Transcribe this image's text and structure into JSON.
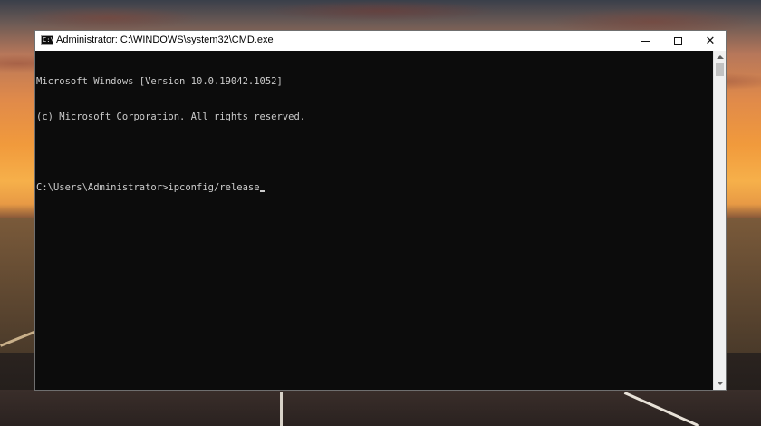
{
  "window": {
    "title": "Administrator: C:\\WINDOWS\\system32\\CMD.exe",
    "app_icon_glyph": "C:\\"
  },
  "window_controls": {
    "minimize_icon": "minimize-icon",
    "maximize_icon": "maximize-icon",
    "close_glyph": "✕"
  },
  "console": {
    "lines": [
      "Microsoft Windows [Version 10.0.19042.1052]",
      "(c) Microsoft Corporation. All rights reserved.",
      "",
      "C:\\Users\\Administrator>ipconfig/release"
    ]
  },
  "colors": {
    "console_background": "#0c0c0c",
    "console_text": "#cccccc",
    "titlebar": "#ffffff"
  }
}
